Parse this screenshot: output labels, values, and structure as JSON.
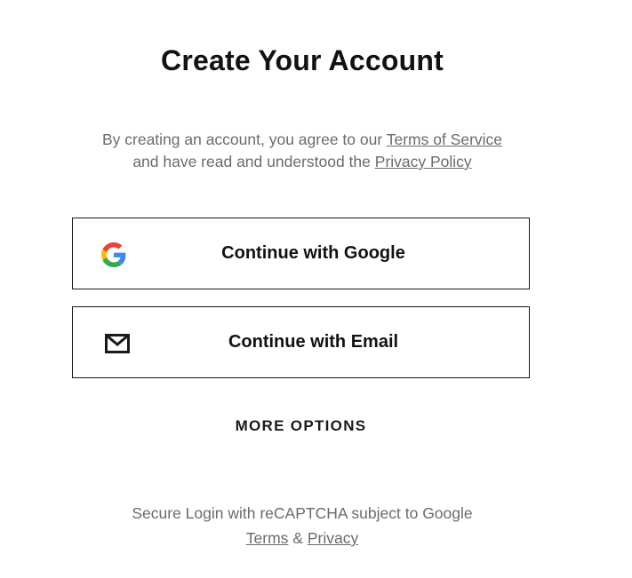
{
  "header": {
    "title": "Create Your Account"
  },
  "legal": {
    "prefix": "By creating an account, you agree to our ",
    "terms_link": "Terms of Service",
    "middle": "and have read and understood the ",
    "privacy_link": "Privacy Policy"
  },
  "buttons": {
    "google_label": "Continue with Google",
    "google_icon": "google-g-icon",
    "email_label": "Continue with Email",
    "email_icon": "envelope-icon"
  },
  "more_options": "MORE OPTIONS",
  "recaptcha": {
    "text": "Secure Login with reCAPTCHA subject to Google",
    "terms_link": "Terms",
    "separator": " & ",
    "privacy_link": "Privacy"
  },
  "colors": {
    "text_primary": "#111111",
    "text_muted": "#6b6b6b",
    "border": "#1a1a1a",
    "google_blue": "#4285F4",
    "google_red": "#EA4335",
    "google_yellow": "#FBBC05",
    "google_green": "#34A853"
  }
}
